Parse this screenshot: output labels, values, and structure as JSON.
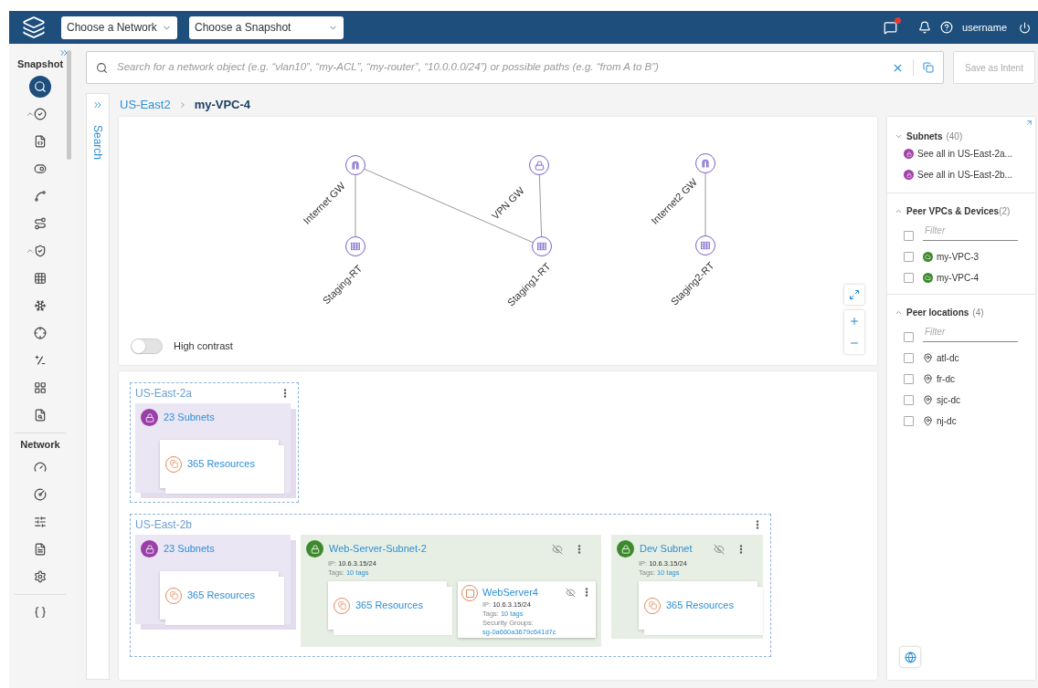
{
  "topbar": {
    "network_select": "Choose a Network",
    "snapshot_select": "Choose a Snapshot",
    "chat_alert": true,
    "user": "username"
  },
  "sidebar": {
    "sections": [
      {
        "title": "Snapshot",
        "items": [
          {
            "kind": "search",
            "selected": true
          },
          {
            "kind": "check-group",
            "selected": false,
            "expanded": true
          },
          {
            "kind": "code",
            "selected": false
          },
          {
            "kind": "toggles",
            "selected": false
          },
          {
            "kind": "graph",
            "selected": false
          },
          {
            "kind": "path",
            "selected": false
          },
          {
            "kind": "shield-group",
            "selected": false,
            "expanded": true
          },
          {
            "kind": "grid",
            "selected": false
          },
          {
            "kind": "hub",
            "selected": false
          },
          {
            "kind": "target",
            "selected": false
          },
          {
            "kind": "plus-minus",
            "selected": false
          },
          {
            "kind": "apps",
            "selected": false
          },
          {
            "kind": "report",
            "selected": false
          }
        ]
      },
      {
        "title": "Network",
        "items": [
          {
            "kind": "gauge",
            "selected": false
          },
          {
            "kind": "gear-gauge",
            "selected": false
          },
          {
            "kind": "sliders",
            "selected": false
          },
          {
            "kind": "file",
            "selected": false
          },
          {
            "kind": "gear",
            "selected": false
          }
        ]
      },
      {
        "items": [
          {
            "kind": "braces",
            "selected": false
          }
        ]
      }
    ]
  },
  "search": {
    "placeholder": "Search for a network object (e.g. “vlan10”, “my-ACL”, “my-router”, “10.0.0.0/24”) or possible paths (e.g. “from A to B”)",
    "save_button": "Save as Intent",
    "save_disabled": true
  },
  "search_panel": {
    "label": "Search"
  },
  "breadcrumb": [
    "US-East2",
    "my-VPC-4"
  ],
  "topology": {
    "nodes": [
      {
        "kind": "gateway",
        "label": "Internet GW"
      },
      {
        "kind": "route-table",
        "label": "Staging-RT"
      },
      {
        "kind": "vpn",
        "label": "VPN GW"
      },
      {
        "kind": "route-table",
        "label": "Staging1-RT"
      },
      {
        "kind": "gateway",
        "label": "Internet2 GW"
      },
      {
        "kind": "route-table",
        "label": "Staging2-RT"
      }
    ],
    "high_contrast": {
      "label": "High contrast",
      "on": false
    }
  },
  "zones": [
    {
      "name": "US-East-2a",
      "items": [
        {
          "kind": "subnet-group",
          "label": "23 Subnets",
          "children": [
            {
              "kind": "resources",
              "label": "365 Resources"
            }
          ]
        }
      ]
    },
    {
      "name": "US-East-2b",
      "items": [
        {
          "kind": "subnet-group",
          "label": "23 Subnets",
          "children": [
            {
              "kind": "resources",
              "label": "365 Resources"
            }
          ]
        },
        {
          "kind": "subnet",
          "label": "Web-Server-Subnet-2",
          "ip_label": "IP:",
          "ip": "10.6.3.15/24",
          "tags_label": "Tags:",
          "tags": "10 tags",
          "children": [
            {
              "kind": "resources",
              "label": "365 Resources"
            },
            {
              "kind": "instance",
              "label": "WebServer4",
              "ip_label": "IP:",
              "ip": "10.6.3.15/24",
              "tags_label": "Tags:",
              "tags": "10 tags",
              "sg_label": "Security Groups:",
              "sg": "sg-0a660a3679c641d7c"
            }
          ]
        },
        {
          "kind": "subnet",
          "label": "Dev Subnet",
          "ip_label": "IP:",
          "ip": "10.6.3.15/24",
          "tags_label": "Tags:",
          "tags": "10 tags",
          "children": [
            {
              "kind": "resources",
              "label": "365 Resources"
            }
          ]
        }
      ]
    }
  ],
  "right_panel": {
    "sections": [
      {
        "kind": "links",
        "title": "Subnets",
        "count": "(40)",
        "items": [
          {
            "kind": "subnet",
            "label": "See all in US-East-2a..."
          },
          {
            "kind": "subnet",
            "label": "See all in US-East-2b..."
          }
        ]
      },
      {
        "kind": "checklist",
        "title": "Peer VPCs & Devices",
        "count": "(2)",
        "filter_placeholder": "Filter",
        "select_all_checked": false,
        "items": [
          {
            "kind": "vpc",
            "label": "my-VPC-3",
            "checked": false
          },
          {
            "kind": "vpc",
            "label": "my-VPC-4",
            "checked": false
          }
        ]
      },
      {
        "kind": "checklist",
        "title": "Peer locations",
        "count": "(4)",
        "filter_placeholder": "Filter",
        "select_all_checked": false,
        "items": [
          {
            "kind": "location",
            "label": "atl-dc",
            "checked": false
          },
          {
            "kind": "location",
            "label": "fr-dc",
            "checked": false
          },
          {
            "kind": "location",
            "label": "sjc-dc",
            "checked": false
          },
          {
            "kind": "location",
            "label": "nj-dc",
            "checked": false
          }
        ]
      }
    ]
  }
}
